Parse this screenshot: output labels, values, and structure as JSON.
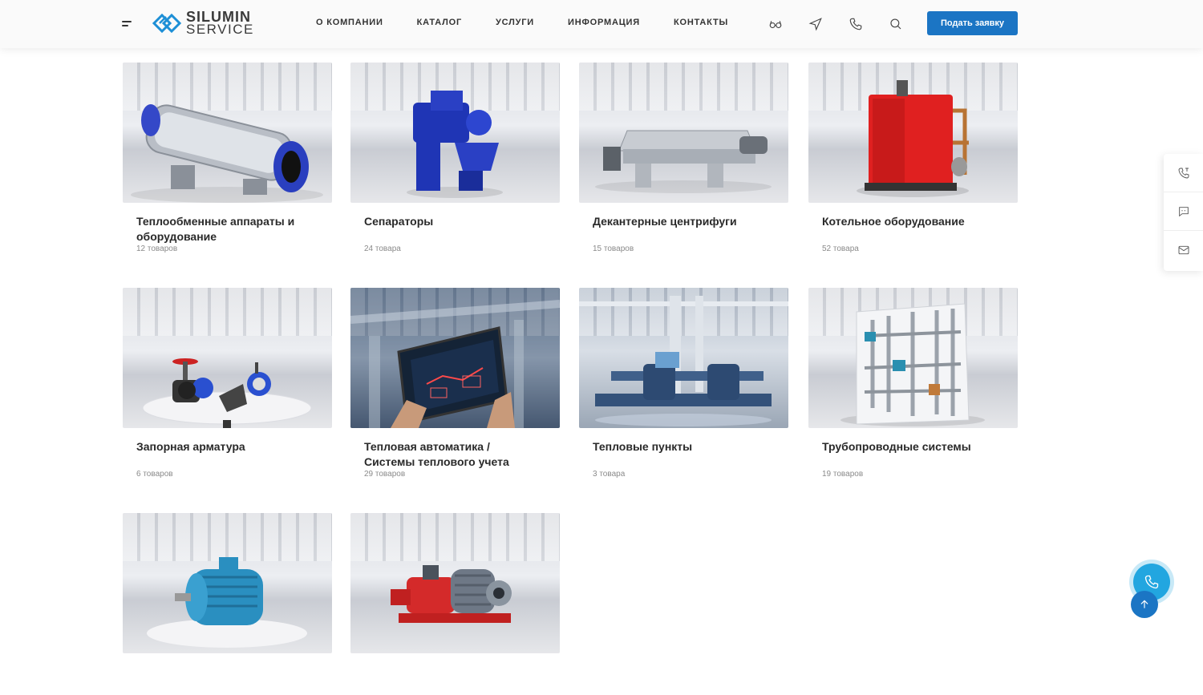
{
  "header": {
    "logo_line1": "SILUMIN",
    "logo_line2": "SERVICE",
    "nav": [
      "О КОМПАНИИ",
      "КАТАЛОГ",
      "УСЛУГИ",
      "ИНФОРМАЦИЯ",
      "КОНТАКТЫ"
    ],
    "icons": [
      "glasses-icon",
      "send-icon",
      "phone-icon",
      "search-icon"
    ],
    "cta_label": "Подать заявку",
    "cta_color": "#1b75c4"
  },
  "categories": [
    {
      "title": "Теплообменные аппараты и оборудование",
      "count": "12 товаров",
      "image": "heat-exchanger"
    },
    {
      "title": "Сепараторы",
      "count": "24 товара",
      "image": "separator"
    },
    {
      "title": "Декантерные центрифуги",
      "count": "15 товаров",
      "image": "decanter-centrifuge"
    },
    {
      "title": "Котельное оборудование",
      "count": "52 товара",
      "image": "boiler"
    },
    {
      "title": "Запорная арматура",
      "count": "6 товаров",
      "image": "valves"
    },
    {
      "title": "Тепловая автоматика / Системы теплового учета",
      "count": "29 товаров",
      "image": "tablet-automation"
    },
    {
      "title": "Тепловые пункты",
      "count": "3 товара",
      "image": "heat-substation"
    },
    {
      "title": "Трубопроводные системы",
      "count": "19 товаров",
      "image": "piping-system"
    },
    {
      "title": "",
      "count": "",
      "image": "electric-motor"
    },
    {
      "title": "",
      "count": "",
      "image": "pump-unit"
    }
  ],
  "side_widget": [
    "callback-icon",
    "chat-icon",
    "mail-icon"
  ],
  "floating": {
    "call": "phone-icon",
    "scroll_top": "arrow-up-icon"
  }
}
